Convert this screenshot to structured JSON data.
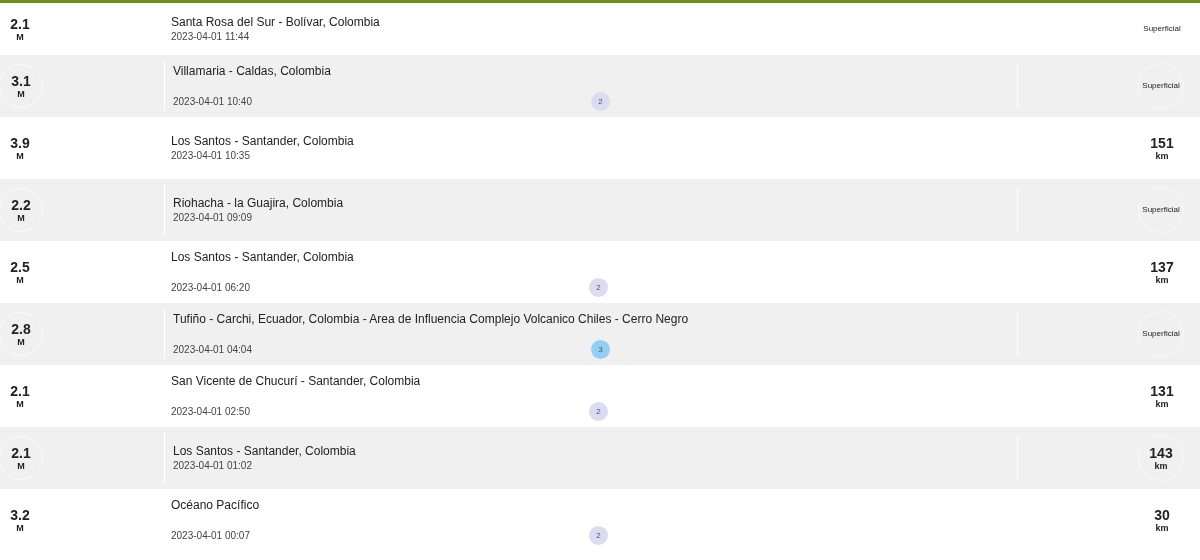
{
  "events": [
    {
      "magnitude": "2.1",
      "magnitude_unit": "M",
      "place": "Santa Rosa del Sur - Bolívar, Colombia",
      "time": "2023-04-01 11:44",
      "highlighted": false,
      "depth": "Superficial"
    },
    {
      "magnitude": "3.1",
      "magnitude_unit": "M",
      "place": "Villamaria - Caldas, Colombia",
      "time": "2023-04-01 10:40",
      "highlighted": true,
      "badge": {
        "text": "2",
        "color": "#dddbf2"
      },
      "depth": "Superficial"
    },
    {
      "magnitude": "3.9",
      "magnitude_unit": "M",
      "place": "Los Santos - Santander, Colombia",
      "time": "2023-04-01 10:35",
      "highlighted": false,
      "depth": "151",
      "depth_unit": "km"
    },
    {
      "magnitude": "2.2",
      "magnitude_unit": "M",
      "place": "Riohacha - la Guajira, Colombia",
      "time": "2023-04-01 09:09",
      "highlighted": true,
      "depth": "Superficial"
    },
    {
      "magnitude": "2.5",
      "magnitude_unit": "M",
      "place": "Los Santos - Santander, Colombia",
      "time": "2023-04-01 06:20",
      "highlighted": false,
      "badge": {
        "text": "2",
        "color": "#dddbf2"
      },
      "depth": "137",
      "depth_unit": "km"
    },
    {
      "magnitude": "2.8",
      "magnitude_unit": "M",
      "place": "Tufiño - Carchi, Ecuador, Colombia - Area de Influencia Complejo Volcanico Chiles - Cerro Negro",
      "time": "2023-04-01 04:04",
      "highlighted": true,
      "badge": {
        "text": "3",
        "color": "#93cff5"
      },
      "depth": "Superficial"
    },
    {
      "magnitude": "2.1",
      "magnitude_unit": "M",
      "place": "San Vicente de Chucurí - Santander, Colombia",
      "time": "2023-04-01 02:50",
      "highlighted": false,
      "badge": {
        "text": "2",
        "color": "#dddbf2"
      },
      "depth": "131",
      "depth_unit": "km"
    },
    {
      "magnitude": "2.1",
      "magnitude_unit": "M",
      "place": "Los Santos - Santander, Colombia",
      "time": "2023-04-01 01:02",
      "highlighted": true,
      "depth": "143",
      "depth_unit": "km"
    },
    {
      "magnitude": "3.2",
      "magnitude_unit": "M",
      "place": "Océano Pacífico",
      "time": "2023-04-01 00:07",
      "highlighted": false,
      "badge": {
        "text": "2",
        "color": "#dddbf2"
      },
      "depth": "30",
      "depth_unit": "km"
    }
  ]
}
